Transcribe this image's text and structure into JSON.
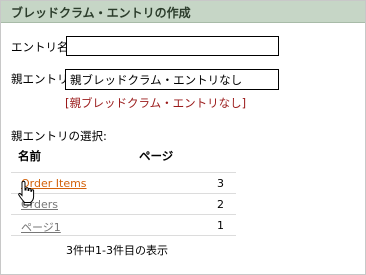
{
  "panel": {
    "title": "ブレッドクラム・エントリの作成"
  },
  "form": {
    "entry_name_label": "エントリ名",
    "entry_name_value": "",
    "parent_label": "親エントリ",
    "parent_value": "親ブレッドクラム・エントリなし",
    "parent_none_link": "[親ブレッドクラム・エントリなし]"
  },
  "select": {
    "heading": "親エントリの選択:",
    "columns": [
      "名前",
      "ページ"
    ],
    "rows": [
      {
        "name": "Order Items",
        "page": "3"
      },
      {
        "name": "Orders",
        "page": "2"
      },
      {
        "name": "ページ1",
        "page": "1"
      }
    ],
    "pager_text": "3件中1-3件目の表示"
  },
  "colors": {
    "header_bg": "#c6d6c6",
    "link_active": "#d4620a",
    "link_visited": "#777777",
    "error_text": "#9a1a1a"
  }
}
